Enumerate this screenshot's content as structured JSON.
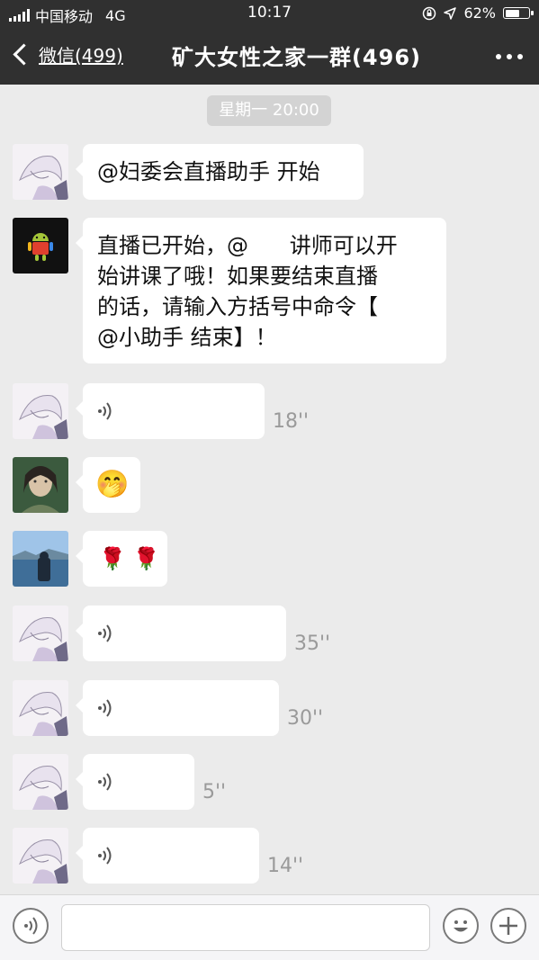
{
  "status_bar": {
    "carrier": "中国移动",
    "network": "4G",
    "time": "10:17",
    "battery": "62%",
    "battery_level": 0.62
  },
  "nav": {
    "back_label": "微信(499)",
    "title": "矿大女性之家一群(496)"
  },
  "timestamp": "星期一 20:00",
  "messages": [
    {
      "type": "text",
      "text": "@妇委会直播助手 开始",
      "avatar": "anime-sketch-avatar"
    },
    {
      "type": "text",
      "text": "直播已开始，@      讲师可以开\n始讲课了哦！如果要结束直播\n的话，请输入方括号中命令【\n@小助手 结束】！",
      "avatar": "android-bot-avatar"
    },
    {
      "type": "voice",
      "duration": "18''",
      "avatar": "anime-sketch-avatar"
    },
    {
      "type": "emoji",
      "emoji": "🤭",
      "avatar": "fantasy-woman-avatar"
    },
    {
      "type": "emoji",
      "emoji": "🌹 🌹",
      "avatar": "seaside-photo-avatar"
    },
    {
      "type": "voice",
      "duration": "35''",
      "avatar": "anime-sketch-avatar"
    },
    {
      "type": "voice",
      "duration": "30''",
      "avatar": "anime-sketch-avatar"
    },
    {
      "type": "voice",
      "duration": "5''",
      "avatar": "anime-sketch-avatar"
    },
    {
      "type": "voice",
      "duration": "14''",
      "avatar": "anime-sketch-avatar"
    }
  ],
  "input": {
    "value": "",
    "placeholder": ""
  },
  "colors": {
    "header_bg": "#303030",
    "chat_bg": "#ebebeb",
    "bubble_bg": "#ffffff",
    "timestamp_bg": "#d3d3d3"
  }
}
